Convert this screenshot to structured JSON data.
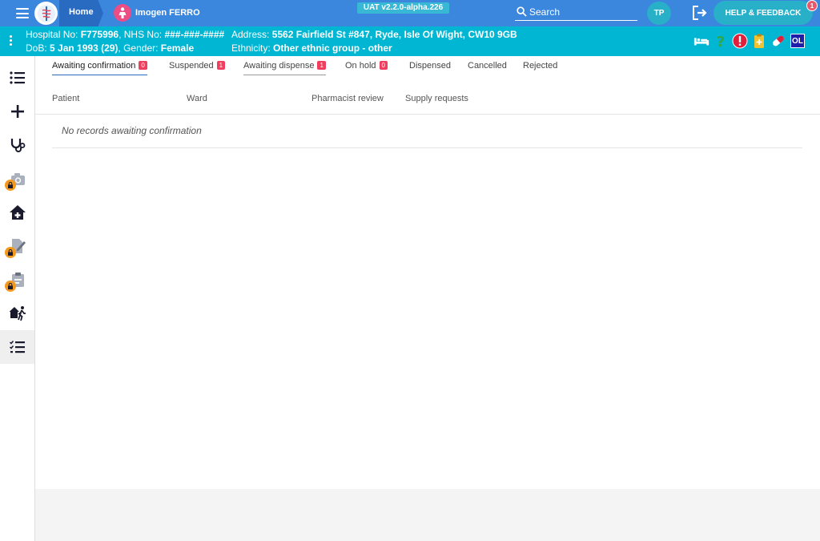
{
  "header": {
    "breadcrumb_home": "Home",
    "patient_name": "Imogen FERRO",
    "version": "UAT v2.2.0-alpha.226",
    "search_label": "Search",
    "user_initials": "TP",
    "help_label": "HELP & FEEDBACK",
    "help_badge": "1",
    "colors": {
      "bar": "#3a87dd",
      "home": "#2a6bc2",
      "accent": "#28b0c8",
      "patient_icon": "#ec4d85"
    }
  },
  "banner": {
    "hospital_label": "Hospital No:",
    "hospital_no": "F775996",
    "nhs_label": ", NHS No:",
    "nhs_no": "###-###-####",
    "dob_label": "DoB:",
    "dob": "5 Jan 1993 (29)",
    "gender_label": ", Gender:",
    "gender": "Female",
    "address_label": "Address:",
    "address": "5562 Fairfield St #847, Ryde, Isle Of Wight, CW10 9GB",
    "ethnicity_label": "Ethnicity:",
    "ethnicity": "Other ethnic group - other",
    "ol_label": "OL",
    "icons": [
      "bed-icon",
      "question-icon",
      "alert-icon",
      "clipboard-icon",
      "pill-icon",
      "ol-icon"
    ],
    "color": "#00b6d3"
  },
  "sidebar": {
    "items": [
      {
        "name": "list-icon",
        "locked": false
      },
      {
        "name": "plus-icon",
        "locked": false
      },
      {
        "name": "stethoscope-icon",
        "locked": false
      },
      {
        "name": "camera-icon",
        "locked": true
      },
      {
        "name": "home-medical-icon",
        "locked": false
      },
      {
        "name": "document-edit-icon",
        "locked": true
      },
      {
        "name": "clipboard-check-icon",
        "locked": true
      },
      {
        "name": "discharge-icon",
        "locked": false
      },
      {
        "name": "checklist-icon",
        "locked": false,
        "active": true
      }
    ]
  },
  "tabs": [
    {
      "label": "Awaiting confirmation",
      "badge": "0",
      "active": true
    },
    {
      "label": "Suspended",
      "badge": "1"
    },
    {
      "label": "Awaiting dispense",
      "badge": "1"
    },
    {
      "label": "On hold",
      "badge": "0"
    },
    {
      "label": "Dispensed"
    },
    {
      "label": "Cancelled"
    },
    {
      "label": "Rejected"
    }
  ],
  "table": {
    "columns": [
      "Patient",
      "Ward",
      "Pharmacist review",
      "Supply requests"
    ],
    "empty_message": "No records awaiting confirmation"
  }
}
